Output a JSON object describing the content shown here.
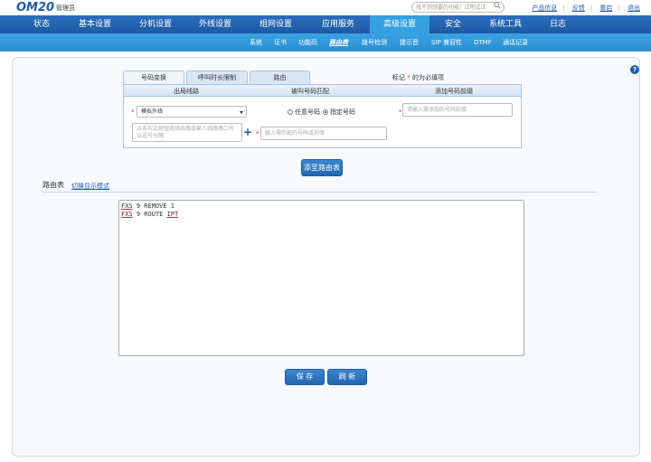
{
  "header": {
    "logo": "OM20",
    "user": "管理员",
    "search_placeholder": "找不到想要的功能? 试用试试",
    "links": [
      "产品信息",
      "反馈",
      "重启",
      "退出"
    ]
  },
  "main_nav": {
    "items": [
      "状态",
      "基本设置",
      "分机设置",
      "外线设置",
      "组网设置",
      "应用服务",
      "高级设置",
      "安全",
      "系统工具",
      "日志"
    ],
    "active": "高级设置"
  },
  "sub_nav": {
    "items": [
      "系统",
      "证书",
      "功能码",
      "路由表",
      "拨号检测",
      "提示音",
      "SIP 兼容性",
      "DTMF",
      "通话记录"
    ],
    "active": "路由表"
  },
  "tabs": [
    "号码变换",
    "呼叫时长限制",
    "路由"
  ],
  "required_note": {
    "prefix": "标记",
    "star": "*",
    "suffix": "的为必填项"
  },
  "form": {
    "col1": "出局线路",
    "col2": "被叫号码匹配",
    "col3": "添加号码前缀",
    "line_select": "模拟外线",
    "line_hint": "点击右边按钮选择线路或输入线路路口号以逗号分隔",
    "radio_any": "任意号码",
    "radio_specific": "指定号码",
    "prefix_placeholder": "请输入需添加的号码前缀",
    "match_placeholder": "输入需匹配的号码或前缀",
    "add_button": "添至路由表"
  },
  "route_table": {
    "label": "路由表",
    "toggle_link": "切换显示模式",
    "lines": [
      {
        "a": "FXS",
        "b": " 9 REMOVE 1",
        "c": ""
      },
      {
        "a": "FXS",
        "b": " 9 ROUTE ",
        "c": "IPT"
      }
    ]
  },
  "buttons": {
    "save": "保 存",
    "refresh": "刷 新"
  },
  "colors": {
    "nav_blue": "#1d5aa3",
    "sub_blue": "#3aa3e3",
    "required_red": "#d9302f"
  }
}
